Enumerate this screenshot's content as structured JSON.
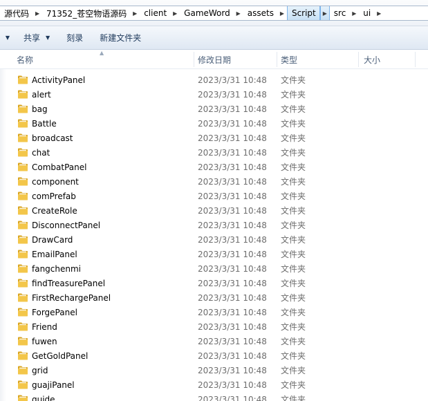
{
  "address_bar": {
    "crumbs": [
      "源代码",
      "71352_苍空物语源码",
      "client",
      "GameWord",
      "assets",
      "Script",
      "src",
      "ui"
    ],
    "current_index": 5
  },
  "command_bar": {
    "share": "共享",
    "burn": "刻录",
    "new_folder": "新建文件夹"
  },
  "columns": {
    "name": "名称",
    "date": "修改日期",
    "type": "类型",
    "size": "大小"
  },
  "folder_color": "#f3c64a",
  "files": [
    {
      "name": "ActivityPanel",
      "date": "2023/3/31 10:48",
      "type": "文件夹"
    },
    {
      "name": "alert",
      "date": "2023/3/31 10:48",
      "type": "文件夹"
    },
    {
      "name": "bag",
      "date": "2023/3/31 10:48",
      "type": "文件夹"
    },
    {
      "name": "Battle",
      "date": "2023/3/31 10:48",
      "type": "文件夹"
    },
    {
      "name": "broadcast",
      "date": "2023/3/31 10:48",
      "type": "文件夹"
    },
    {
      "name": "chat",
      "date": "2023/3/31 10:48",
      "type": "文件夹"
    },
    {
      "name": "CombatPanel",
      "date": "2023/3/31 10:48",
      "type": "文件夹"
    },
    {
      "name": "component",
      "date": "2023/3/31 10:48",
      "type": "文件夹"
    },
    {
      "name": "comPrefab",
      "date": "2023/3/31 10:48",
      "type": "文件夹"
    },
    {
      "name": "CreateRole",
      "date": "2023/3/31 10:48",
      "type": "文件夹"
    },
    {
      "name": "DisconnectPanel",
      "date": "2023/3/31 10:48",
      "type": "文件夹"
    },
    {
      "name": "DrawCard",
      "date": "2023/3/31 10:48",
      "type": "文件夹"
    },
    {
      "name": "EmailPanel",
      "date": "2023/3/31 10:48",
      "type": "文件夹"
    },
    {
      "name": "fangchenmi",
      "date": "2023/3/31 10:48",
      "type": "文件夹"
    },
    {
      "name": "findTreasurePanel",
      "date": "2023/3/31 10:48",
      "type": "文件夹"
    },
    {
      "name": "FirstRechargePanel",
      "date": "2023/3/31 10:48",
      "type": "文件夹"
    },
    {
      "name": "ForgePanel",
      "date": "2023/3/31 10:48",
      "type": "文件夹"
    },
    {
      "name": "Friend",
      "date": "2023/3/31 10:48",
      "type": "文件夹"
    },
    {
      "name": "fuwen",
      "date": "2023/3/31 10:48",
      "type": "文件夹"
    },
    {
      "name": "GetGoldPanel",
      "date": "2023/3/31 10:48",
      "type": "文件夹"
    },
    {
      "name": "grid",
      "date": "2023/3/31 10:48",
      "type": "文件夹"
    },
    {
      "name": "guajiPanel",
      "date": "2023/3/31 10:48",
      "type": "文件夹"
    },
    {
      "name": "guide",
      "date": "2023/3/31 10:48",
      "type": "文件夹"
    }
  ]
}
